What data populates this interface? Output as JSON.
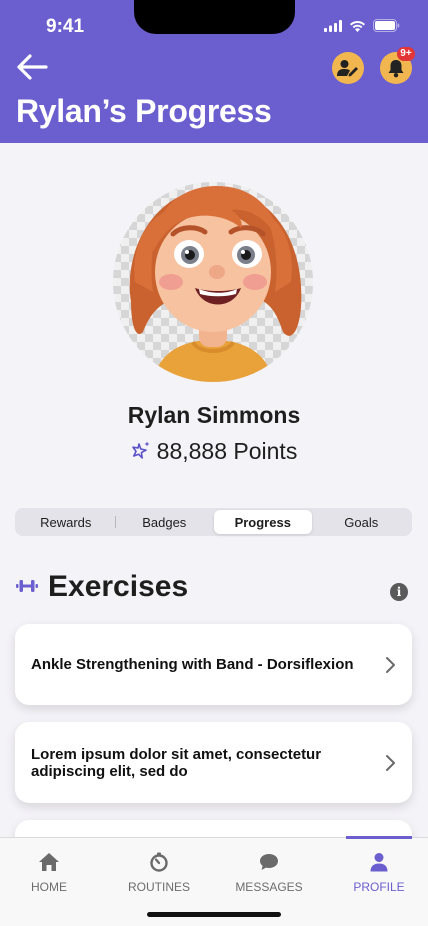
{
  "status_bar": {
    "time": "9:41"
  },
  "header": {
    "title": "Rylan’s Progress",
    "notification_count": "9+"
  },
  "profile": {
    "name": "Rylan Simmons",
    "points": "88,888 Points"
  },
  "tabs": [
    {
      "label": "Rewards",
      "active": false
    },
    {
      "label": "Badges",
      "active": false
    },
    {
      "label": "Progress",
      "active": true
    },
    {
      "label": "Goals",
      "active": false
    }
  ],
  "exercises": {
    "title": "Exercises",
    "items": [
      {
        "title": "Ankle Strengthening with Band - Dorsiflexion"
      },
      {
        "title": "Lorem ipsum dolor sit amet, consectetur adipiscing elit, sed do"
      }
    ]
  },
  "tabbar": {
    "items": [
      {
        "label": "HOME",
        "icon": "home-icon",
        "active": false
      },
      {
        "label": "ROUTINES",
        "icon": "stopwatch-icon",
        "active": false
      },
      {
        "label": "MESSAGES",
        "icon": "chat-bubble-icon",
        "active": false
      },
      {
        "label": "PROFILE",
        "icon": "person-icon",
        "active": true
      }
    ]
  },
  "colors": {
    "brand": "#6b5fcf",
    "accent": "#f1b64f",
    "badge": "#e23636"
  }
}
